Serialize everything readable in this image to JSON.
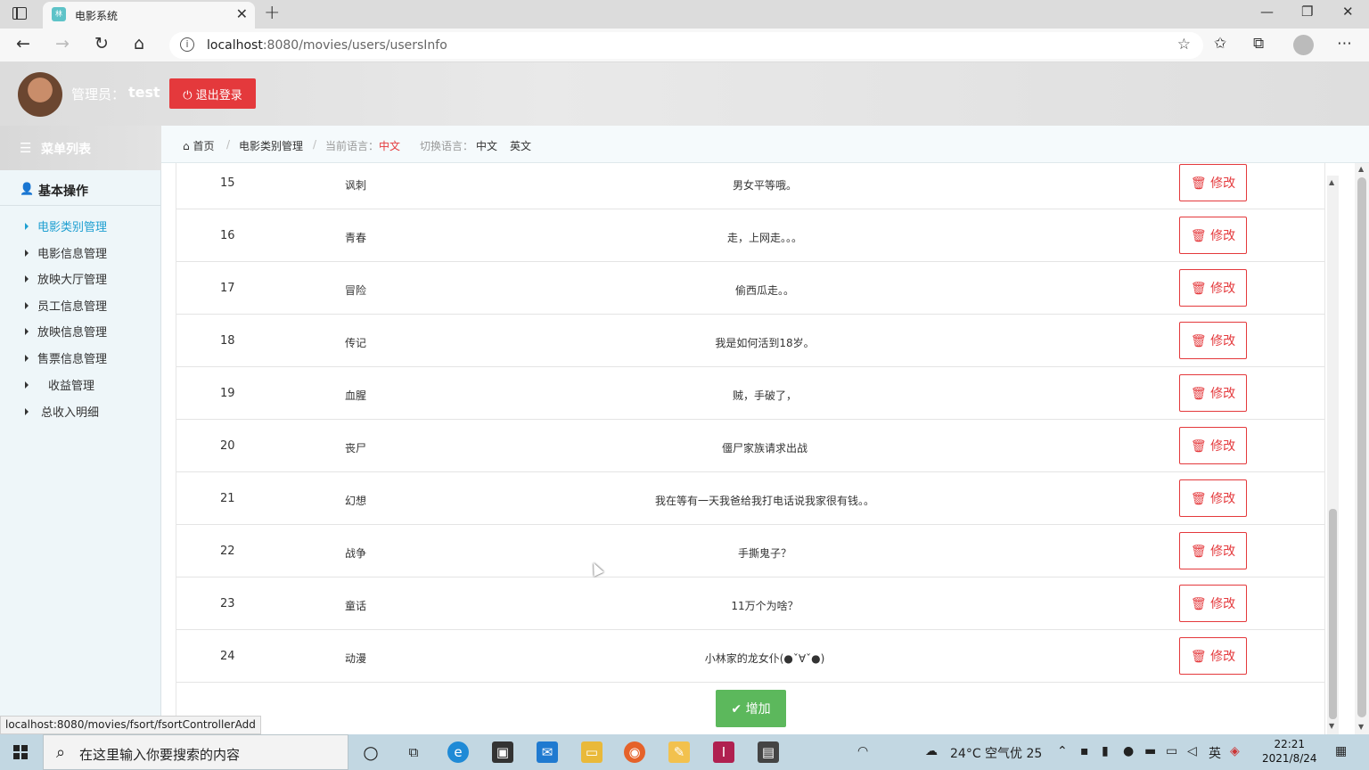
{
  "browser": {
    "tab_title": "电影系统",
    "favicon_text": "林",
    "tab_close": "✕",
    "new_tab": "+",
    "url_host": "localhost",
    "url_rest": ":8080/movies/users/usersInfo",
    "win_min": "—",
    "win_max": "❐",
    "win_close": "✕"
  },
  "header": {
    "admin_label": "管理员：",
    "admin_name": "test",
    "logout_label": "退出登录"
  },
  "sidebar": {
    "menu_title": "菜单列表",
    "section_title": "基本操作",
    "items": [
      {
        "label": "电影类别管理"
      },
      {
        "label": "电影信息管理"
      },
      {
        "label": "放映大厅管理"
      },
      {
        "label": "员工信息管理"
      },
      {
        "label": "放映信息管理"
      },
      {
        "label": "售票信息管理"
      },
      {
        "label": "收益管理"
      },
      {
        "label": "总收入明细"
      }
    ],
    "active_index": 0
  },
  "breadcrumb": {
    "home": "首页",
    "current": "电影类别管理",
    "lang_label": "当前语言：",
    "lang_value": "中文",
    "switch_label": "切换语言：",
    "lang_zh": "中文",
    "lang_en": "英文"
  },
  "table": {
    "edit_label": "修改",
    "rows": [
      {
        "id": "15",
        "name": "讽刺",
        "desc": "男女平等哦。"
      },
      {
        "id": "16",
        "name": "青春",
        "desc": "走，上网走。。。"
      },
      {
        "id": "17",
        "name": "冒险",
        "desc": "偷西瓜走。。"
      },
      {
        "id": "18",
        "name": "传记",
        "desc": "我是如何活到18岁。"
      },
      {
        "id": "19",
        "name": "血腥",
        "desc": "贼，手破了，"
      },
      {
        "id": "20",
        "name": "丧尸",
        "desc": "僵尸家族请求出战"
      },
      {
        "id": "21",
        "name": "幻想",
        "desc": "我在等有一天我爸给我打电话说我家很有钱。。"
      },
      {
        "id": "22",
        "name": "战争",
        "desc": "手撕鬼子？"
      },
      {
        "id": "23",
        "name": "童话",
        "desc": "11万个为啥？"
      },
      {
        "id": "24",
        "name": "动漫",
        "desc": "小林家的龙女仆(●ˇ∀ˇ●)"
      }
    ],
    "add_label": "增加"
  },
  "status_url": "localhost:8080/movies/fsort/fsortControllerAdd",
  "taskbar": {
    "search_placeholder": "在这里输入你要搜索的内容",
    "weather": "24°C 空气优 25",
    "time": "22:21",
    "date": "2021/8/24"
  }
}
